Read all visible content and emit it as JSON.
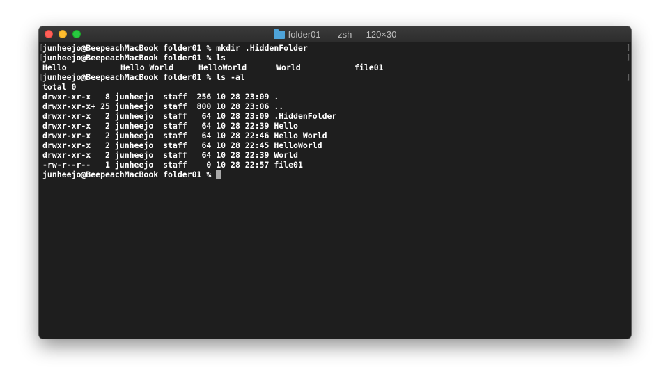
{
  "window": {
    "title": "folder01 — -zsh — 120×30",
    "folder_icon": "folder-icon",
    "controls": [
      "close",
      "minimize",
      "zoom"
    ]
  },
  "terminal": {
    "prompt": "junheejo@BeepeachMacBook folder01 % ",
    "commands": [
      "mkdir .HiddenFolder",
      "ls",
      "ls -al"
    ],
    "ls_output": [
      "Hello",
      "Hello World",
      "HelloWorld",
      "World",
      "file01"
    ],
    "total_line": "total 0",
    "listing": [
      "drwxr-xr-x   8 junheejo  staff  256 10 28 23:09 .",
      "drwxr-xr-x+ 25 junheejo  staff  800 10 28 23:06 ..",
      "drwxr-xr-x   2 junheejo  staff   64 10 28 23:09 .HiddenFolder",
      "drwxr-xr-x   2 junheejo  staff   64 10 28 22:39 Hello",
      "drwxr-xr-x   2 junheejo  staff   64 10 28 22:46 Hello World",
      "drwxr-xr-x   2 junheejo  staff   64 10 28 22:45 HelloWorld",
      "drwxr-xr-x   2 junheejo  staff   64 10 28 22:39 World",
      "-rw-r--r--   1 junheejo  staff    0 10 28 22:57 file01"
    ],
    "mark_left": "[",
    "mark_right": "]"
  },
  "colors": {
    "background": "#1e1e1e",
    "text": "#ffffff",
    "close": "#ff5f57",
    "minimize": "#febc2e",
    "zoom": "#28c840",
    "folder": "#4ea3d8"
  }
}
